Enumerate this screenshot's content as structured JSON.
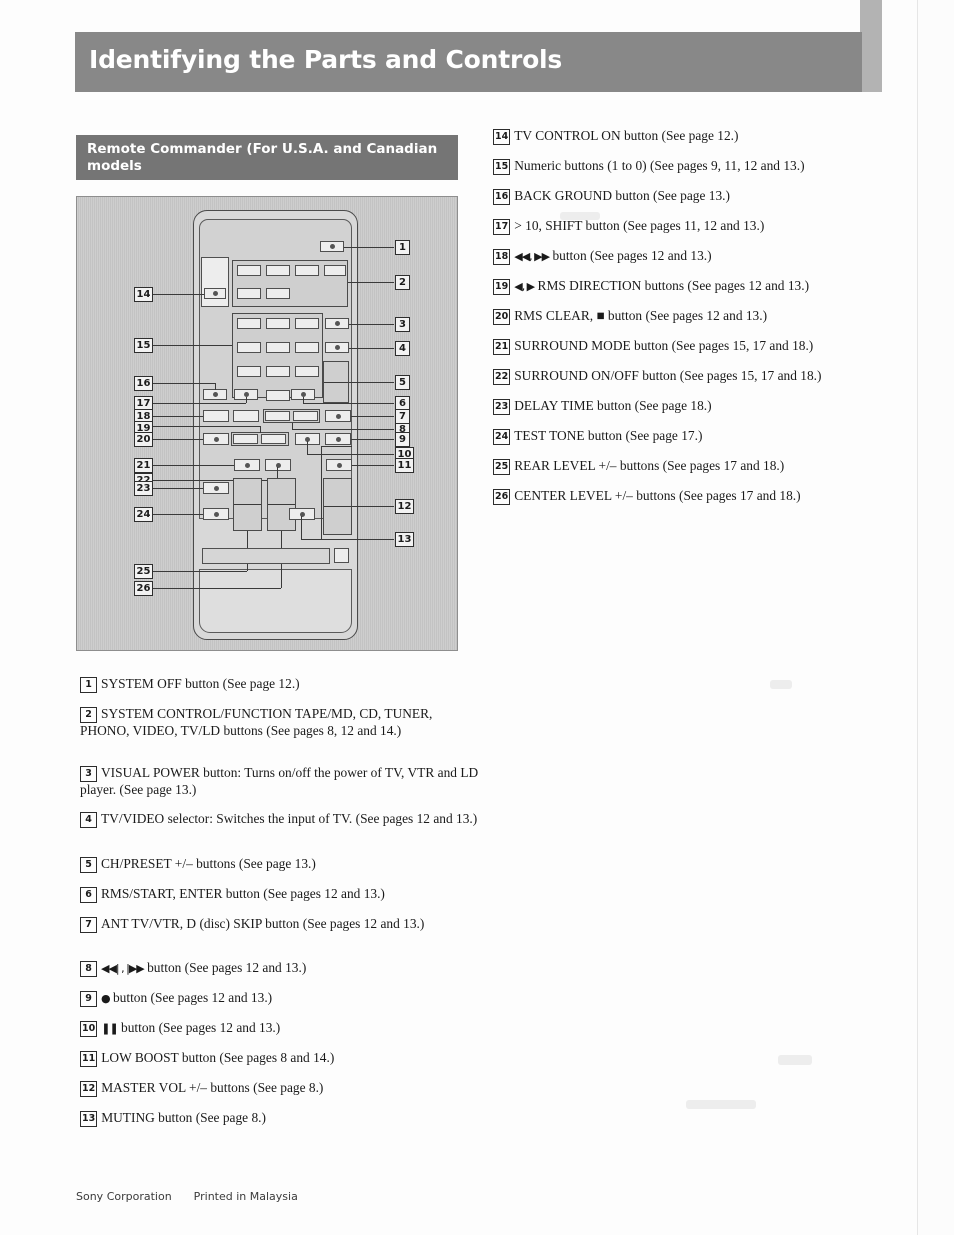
{
  "page": {
    "title": "Identifying the Parts and Controls",
    "section_title": "Remote Commander (For U.S.A. and Canadian models"
  },
  "footer": {
    "company": "Sony Corporation",
    "printed": "Printed in Malaysia"
  },
  "colors": {
    "title_bar": "#888888",
    "sub_bar": "#757575",
    "illustration_bg": "#c9c9c9",
    "text": "#1a1a1a"
  },
  "illustration": {
    "name": "remote-commander-diagram",
    "left_callouts": [
      "14",
      "15",
      "16",
      "17",
      "18",
      "19",
      "20",
      "21",
      "22",
      "23",
      "24",
      "25",
      "26"
    ],
    "right_callouts": [
      "1",
      "2",
      "3",
      "4",
      "5",
      "6",
      "7",
      "8",
      "9",
      "10",
      "11",
      "12",
      "13"
    ]
  },
  "left_list": [
    {
      "num": "1",
      "text": "SYSTEM OFF button (See page 12.)"
    },
    {
      "num": "2",
      "text": "SYSTEM CONTROL/FUNCTION TAPE/MD, CD, TUNER, PHONO, VIDEO, TV/LD buttons (See pages 8, 12 and 14.)"
    },
    {
      "num": "3",
      "text": "VISUAL POWER button: Turns on/off the power of TV, VTR and LD player. (See page 13.)"
    },
    {
      "num": "4",
      "text": "TV/VIDEO selector: Switches the input of TV. (See pages 12 and 13.)"
    },
    {
      "num": "5",
      "text": "CH/PRESET +/– buttons (See page 13.)"
    },
    {
      "num": "6",
      "text": "RMS/START, ENTER button (See pages 12 and 13.)"
    },
    {
      "num": "7",
      "text": "ANT TV/VTR, D (disc) SKIP button (See pages 12 and 13.)"
    },
    {
      "num": "8",
      "text": "button (See pages 12 and 13.)",
      "glyph": "◀◀| , |▶▶"
    },
    {
      "num": "9",
      "text": "button (See pages 12 and 13.)",
      "glyph": "●"
    },
    {
      "num": "10",
      "text": "button (See pages 12 and 13.)",
      "glyph": "❚❚"
    },
    {
      "num": "11",
      "text": "LOW BOOST button (See pages 8 and 14.)"
    },
    {
      "num": "12",
      "text": "MASTER VOL +/– buttons (See page 8.)"
    },
    {
      "num": "13",
      "text": "MUTING button (See page 8.)"
    }
  ],
  "right_list": [
    {
      "num": "14",
      "text": "TV CONTROL ON button (See page 12.)"
    },
    {
      "num": "15",
      "text": "Numeric buttons (1 to 0) (See pages 9, 11, 12 and 13.)"
    },
    {
      "num": "16",
      "text": "BACK GROUND button (See page 13.)"
    },
    {
      "num": "17",
      "text": "> 10, SHIFT button (See pages 11, 12 and 13.)"
    },
    {
      "num": "18",
      "text": "button (See pages 12 and 13.)",
      "glyph": "◀◀, ▶▶"
    },
    {
      "num": "19",
      "text": "RMS DIRECTION buttons (See pages 12 and 13.)",
      "glyph": "◀, ▶"
    },
    {
      "num": "20",
      "text": "RMS CLEAR, ■ button (See pages 12 and 13.)"
    },
    {
      "num": "21",
      "text": "SURROUND MODE button  (See pages 15, 17 and 18.)"
    },
    {
      "num": "22",
      "text": "SURROUND ON/OFF button  (See pages 15, 17 and 18.)"
    },
    {
      "num": "23",
      "text": "DELAY TIME button (See page 18.)"
    },
    {
      "num": "24",
      "text": "TEST TONE button (See page 17.)"
    },
    {
      "num": "25",
      "text": "REAR LEVEL +/– buttons (See pages 17 and 18.)"
    },
    {
      "num": "26",
      "text": "CENTER LEVEL +/– buttons (See pages 17 and 18.)"
    }
  ]
}
